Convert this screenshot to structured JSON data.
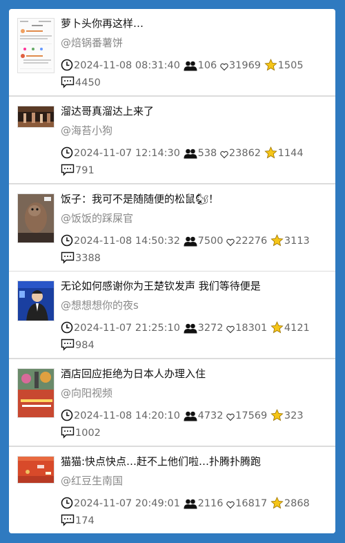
{
  "posts": [
    {
      "title": "萝卜头你再这样…",
      "author": "@焙锅番薯饼",
      "time": "2024-11-08 08:31:40",
      "viewers": "106",
      "likes": "31969",
      "favorites": "1505",
      "comments": "4450"
    },
    {
      "title": "溜达哥真溜达上来了",
      "author": "@海苔小狗",
      "time": "2024-11-07 12:14:30",
      "viewers": "538",
      "likes": "23862",
      "favorites": "1144",
      "comments": "791"
    },
    {
      "title": "饭子：我可不是随随便的松鼠🐿！",
      "author": "@饭饭的踩屎官",
      "time": "2024-11-08 14:50:32",
      "viewers": "7500",
      "likes": "22276",
      "favorites": "3113",
      "comments": "3388"
    },
    {
      "title": "无论如何感谢你为王楚钦发声 我们等待便是",
      "author": "@想想想你的夜s",
      "time": "2024-11-07 21:25:10",
      "viewers": "3272",
      "likes": "18301",
      "favorites": "4121",
      "comments": "984"
    },
    {
      "title": "酒店回应拒绝为日本人办理入住",
      "author": "@向阳视频",
      "time": "2024-11-08 14:20:10",
      "viewers": "4732",
      "likes": "17569",
      "favorites": "323",
      "comments": "1002"
    },
    {
      "title": "猫猫:快点快点…赶不上他们啦…扑腾扑腾跑",
      "author": "@红豆生南国",
      "time": "2024-11-07 20:49:01",
      "viewers": "2116",
      "likes": "16817",
      "favorites": "2868",
      "comments": "174"
    }
  ],
  "icons": {
    "time": "clock-icon",
    "viewers": "people-icon",
    "likes": "heart-icon",
    "favorites": "star-icon",
    "comments": "comment-icon"
  },
  "colors": {
    "background": "#2f7ac0",
    "star": "#f5c518"
  }
}
